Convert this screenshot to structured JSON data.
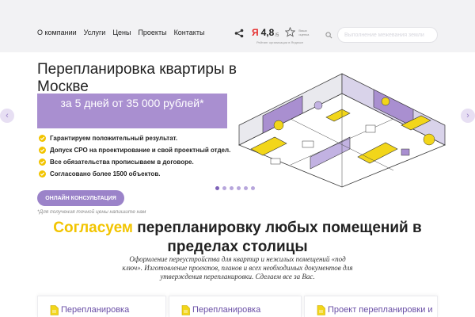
{
  "nav": {
    "items": [
      "О компании",
      "Услуги",
      "Цены",
      "Проекты",
      "Контакты"
    ]
  },
  "rating": {
    "brand": "Я",
    "value": "4,8",
    "unit": "/5",
    "star_label": "Ваша оценка",
    "caption": "Рейтинг организации в Яндексе"
  },
  "search": {
    "placeholder": "Выполнение межевания земли"
  },
  "hero": {
    "title": "Перепланировка квартиры в Москве",
    "price_banner": "за 5 дней от 35 000 рублей*",
    "features": [
      "Гарантируем положительный результат.",
      "Допуск СРО на проектирование и свой проектный отдел.",
      "Все обязательства прописываем в договоре.",
      "Согласовано более 1500 объектов."
    ],
    "consult_button": "ОНЛАЙН КОНСУЛЬТАЦИЯ",
    "price_note": "*Для получения точной цены напишите нам"
  },
  "carousel": {
    "prev": "‹",
    "next": "›",
    "dots": 6,
    "active_dot": 0
  },
  "section": {
    "accent_word": "Согласуем",
    "heading_rest": "перепланировку любых помещений в",
    "heading_line2": "пределах столицы",
    "description": "Оформление переустройства для квартир и нежилых помещений «под ключ». Изготовление проектов, планов и всех необходимых документов для утверждения перепланировки. Сделаем все за Вас."
  },
  "cards": [
    {
      "title": "Перепланировка",
      "icon": "document-icon"
    },
    {
      "title": "Перепланировка",
      "icon": "document-icon"
    },
    {
      "title": "Проект перепланировки и",
      "icon": "document-icon"
    }
  ],
  "colors": {
    "accent_purple": "#a98fd0",
    "accent_yellow": "#f2c400",
    "header_bg": "#f2f2f4"
  }
}
